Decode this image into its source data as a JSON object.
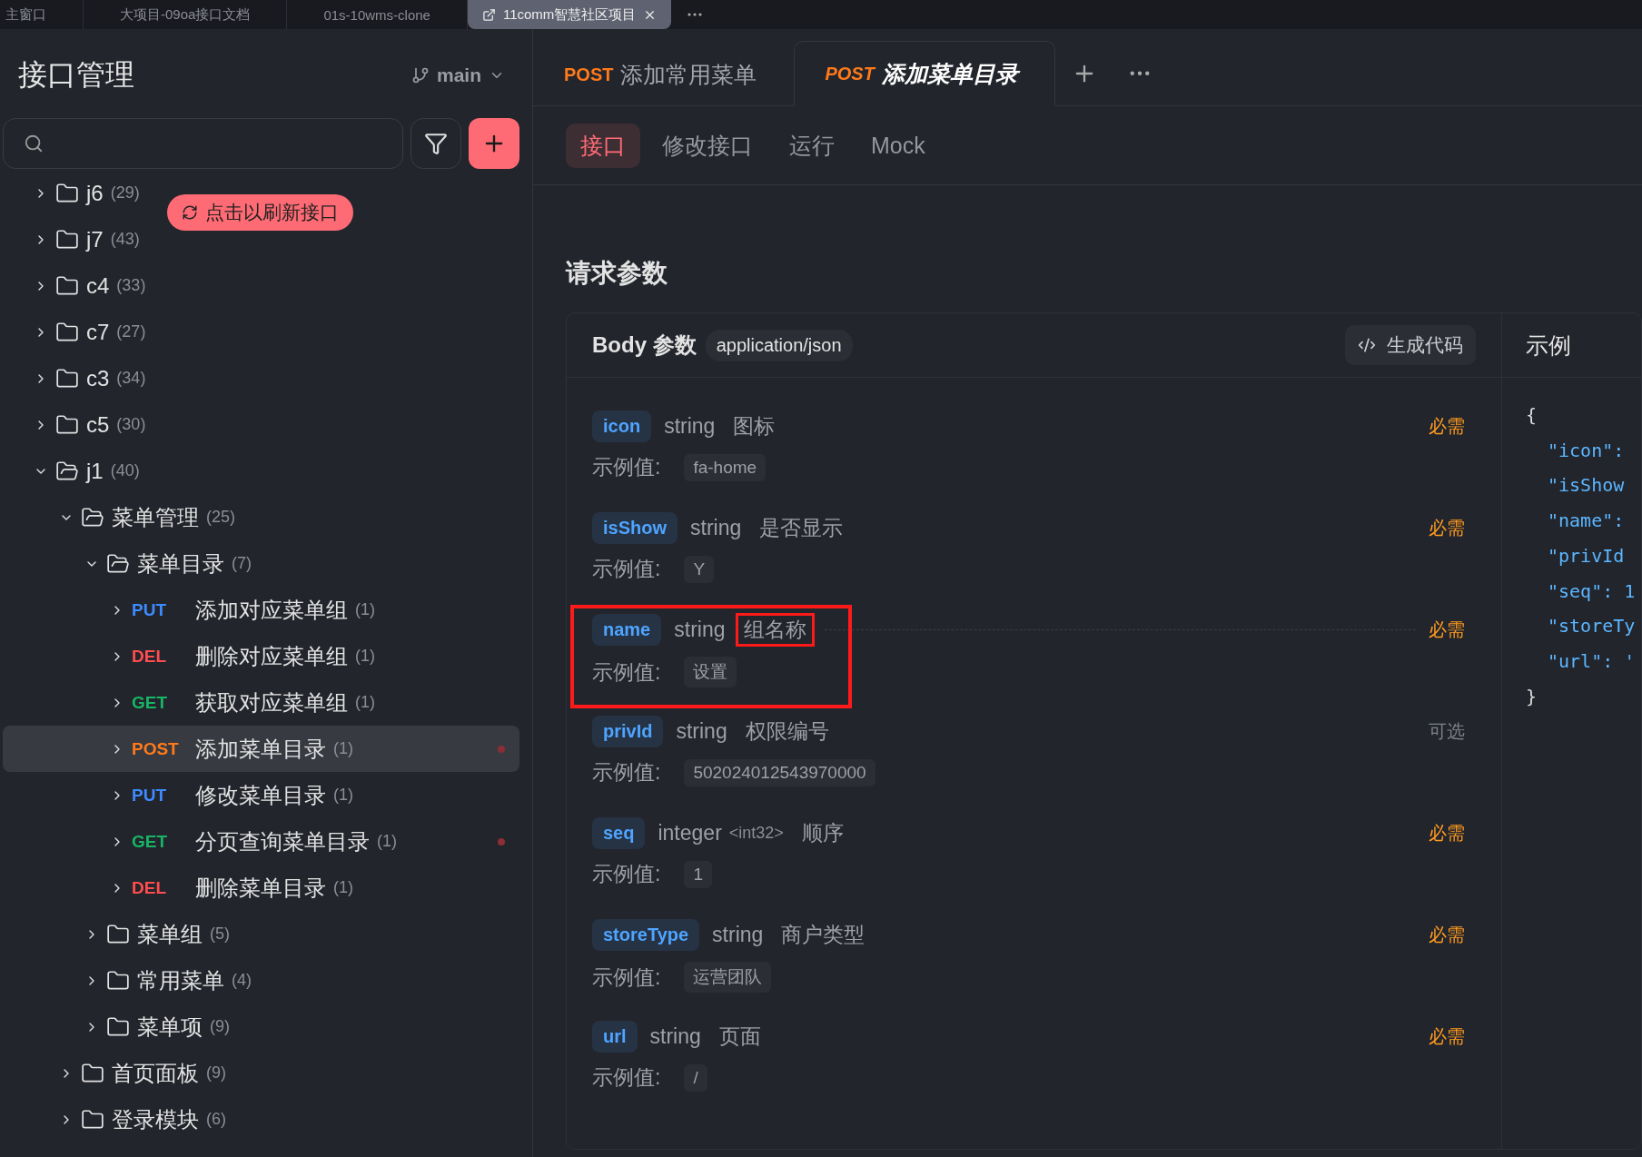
{
  "window_tabs": [
    {
      "label": "主窗口",
      "selected": false
    },
    {
      "label": "大项目-09oa接口文档",
      "selected": false
    },
    {
      "label": "01s-10wms-clone",
      "selected": false
    },
    {
      "label": "11comm智慧社区项目",
      "selected": true
    }
  ],
  "sidebar": {
    "title": "接口管理",
    "branch": "main",
    "refresh_toast": "点击以刷新接口",
    "tree": [
      {
        "kind": "folder",
        "name": "j6",
        "count": "(29)",
        "expanded": false
      },
      {
        "kind": "folder",
        "name": "j7",
        "count": "(43)",
        "expanded": false
      },
      {
        "kind": "folder",
        "name": "c4",
        "count": "(33)",
        "expanded": false
      },
      {
        "kind": "folder",
        "name": "c7",
        "count": "(27)",
        "expanded": false
      },
      {
        "kind": "folder",
        "name": "c3",
        "count": "(34)",
        "expanded": false
      },
      {
        "kind": "folder",
        "name": "c5",
        "count": "(30)",
        "expanded": false
      },
      {
        "kind": "folder",
        "name": "j1",
        "count": "(40)",
        "expanded": true,
        "children": [
          {
            "kind": "folder",
            "name": "菜单管理",
            "count": "(25)",
            "expanded": true,
            "children": [
              {
                "kind": "folder",
                "name": "菜单目录",
                "count": "(7)",
                "expanded": true,
                "children": [
                  {
                    "kind": "endpoint",
                    "method": "PUT",
                    "name": "添加对应菜单组",
                    "count": "(1)",
                    "selected": false,
                    "modified": false
                  },
                  {
                    "kind": "endpoint",
                    "method": "DEL",
                    "name": "删除对应菜单组",
                    "count": "(1)",
                    "selected": false,
                    "modified": false
                  },
                  {
                    "kind": "endpoint",
                    "method": "GET",
                    "name": "获取对应菜单组",
                    "count": "(1)",
                    "selected": false,
                    "modified": false
                  },
                  {
                    "kind": "endpoint",
                    "method": "POST",
                    "name": "添加菜单目录",
                    "count": "(1)",
                    "selected": true,
                    "modified": true
                  },
                  {
                    "kind": "endpoint",
                    "method": "PUT",
                    "name": "修改菜单目录",
                    "count": "(1)",
                    "selected": false,
                    "modified": false
                  },
                  {
                    "kind": "endpoint",
                    "method": "GET",
                    "name": "分页查询菜单目录",
                    "count": "(1)",
                    "selected": false,
                    "modified": true
                  },
                  {
                    "kind": "endpoint",
                    "method": "DEL",
                    "name": "删除菜单目录",
                    "count": "(1)",
                    "selected": false,
                    "modified": false
                  }
                ]
              },
              {
                "kind": "folder",
                "name": "菜单组",
                "count": "(5)",
                "expanded": false
              },
              {
                "kind": "folder",
                "name": "常用菜单",
                "count": "(4)",
                "expanded": false
              },
              {
                "kind": "folder",
                "name": "菜单项",
                "count": "(9)",
                "expanded": false
              }
            ]
          },
          {
            "kind": "folder",
            "name": "首页面板",
            "count": "(9)",
            "expanded": false
          },
          {
            "kind": "folder",
            "name": "登录模块",
            "count": "(6)",
            "expanded": false
          }
        ]
      }
    ]
  },
  "doc_tabs": [
    {
      "method": "POST",
      "title": "添加常用菜单",
      "selected": false
    },
    {
      "method": "POST",
      "title": "添加菜单目录",
      "selected": true
    }
  ],
  "sub_tabs": [
    {
      "label": "接口",
      "selected": true
    },
    {
      "label": "修改接口",
      "selected": false
    },
    {
      "label": "运行",
      "selected": false
    },
    {
      "label": "Mock",
      "selected": false
    }
  ],
  "section_title": "请求参数",
  "body": {
    "title": "Body 参数",
    "content_type": "application/json",
    "generate_button": "生成代码",
    "params": [
      {
        "name": "icon",
        "type": "string",
        "description": "图标",
        "example_label": "示例值:",
        "example": "fa-home",
        "requirement": "必需",
        "required": true,
        "highlighted": false
      },
      {
        "name": "isShow",
        "type": "string",
        "description": "是否显示",
        "example_label": "示例值:",
        "example": "Y",
        "requirement": "必需",
        "required": true,
        "highlighted": false
      },
      {
        "name": "name",
        "type": "string",
        "description": "组名称",
        "example_label": "示例值:",
        "example": "设置",
        "requirement": "必需",
        "required": true,
        "highlighted": true
      },
      {
        "name": "privId",
        "type": "string",
        "description": "权限编号",
        "example_label": "示例值:",
        "example": "502024012543970000",
        "requirement": "可选",
        "required": false,
        "highlighted": false
      },
      {
        "name": "seq",
        "type": "integer",
        "format": "<int32>",
        "description": "顺序",
        "example_label": "示例值:",
        "example": "1",
        "requirement": "必需",
        "required": true,
        "highlighted": false
      },
      {
        "name": "storeType",
        "type": "string",
        "description": "商户类型",
        "example_label": "示例值:",
        "example": "运营团队",
        "requirement": "必需",
        "required": true,
        "highlighted": false
      },
      {
        "name": "url",
        "type": "string",
        "description": "页面",
        "example_label": "示例值:",
        "example": "/",
        "requirement": "必需",
        "required": true,
        "highlighted": false
      }
    ]
  },
  "example": {
    "title": "示例",
    "lines": [
      "{",
      "\"icon\":",
      "\"isShow",
      "\"name\":",
      "\"privId",
      "\"seq\": 1",
      "\"storeTy",
      "\"url\": '",
      "}"
    ]
  }
}
